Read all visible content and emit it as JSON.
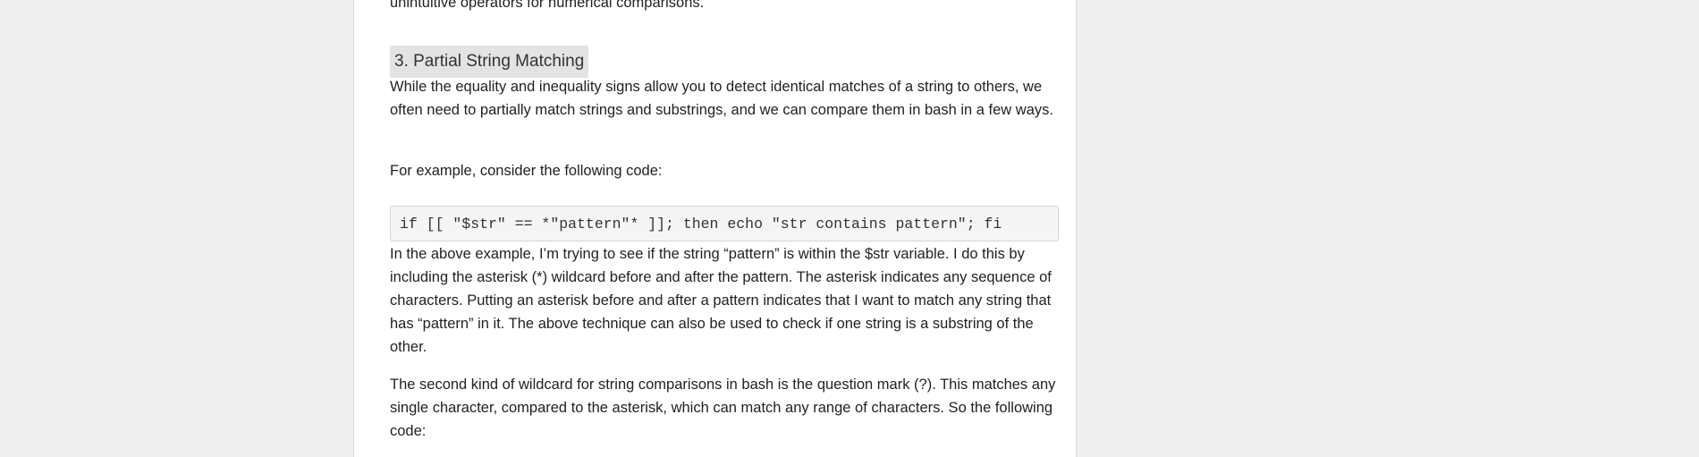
{
  "article": {
    "intro_tail": "unintuitive operators for numerical comparisons.",
    "section_heading": "3. Partial String Matching",
    "para_partial": "While the equality and inequality signs allow you to detect identical matches of a string to others, we often need to partially match strings and substrings, and we can compare them in bash in a few ways.",
    "para_example": "For example, consider the following code:",
    "code_snippet": "if [[ \"$str\" == *\"pattern\"* ]]; then echo \"str contains pattern\"; fi",
    "para_explanation": "In the above example, I’m trying to see if the string “pattern” is within the $str variable. I do this by including the asterisk (*) wildcard before and after the pattern. The asterisk indicates any sequence of characters. Putting an asterisk before and after a pattern indicates that I want to match any string that has “pattern” in it. The above technique can also be used to check if one string is a substring of the other.",
    "para_question_mark": "The second kind of wildcard for string comparisons in bash is the question mark (?). This matches any single character, compared to the asterisk, which can match any range of characters. So the following code:"
  },
  "colors": {
    "page_background": "#efefef",
    "article_background": "#ffffff",
    "heading_background": "#e3e3e3",
    "code_background": "#f5f5f5",
    "text": "#222222"
  }
}
